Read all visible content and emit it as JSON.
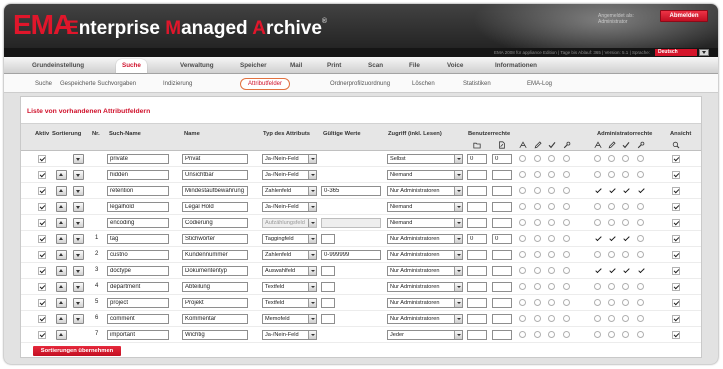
{
  "header": {
    "logo": "EMA",
    "title_parts": [
      "E",
      "nterprise ",
      "M",
      "anaged ",
      "A",
      "rchive",
      "®"
    ],
    "user_label": "Angemeldet als:",
    "user_name": "Administrator",
    "logout_label": "Abmelden"
  },
  "status_bar": {
    "text": "EMA 2008 für appliance Edition | Tage bis Ablauf: 365 | Version: 5.1 | Sprache:",
    "language": "Deutsch"
  },
  "nav": {
    "items": [
      "Grundeinstellung",
      "Suche",
      "Verwaltung",
      "Speicher",
      "Mail",
      "Print",
      "Scan",
      "File",
      "Voice",
      "Informationen"
    ],
    "active_index": 1
  },
  "subnav": {
    "items": [
      "Suche",
      "Gespeicherte Suchvorgaben",
      "Indizierung",
      "Attributfelder",
      "Ordnerprofilzuordnung",
      "Löschen",
      "Statistiken",
      "EMA-Log"
    ],
    "active_index": 3
  },
  "panel": {
    "title": "Liste von vorhandenen Attributfeldern",
    "columns": {
      "active": "Aktiv",
      "sort": "Sortierung",
      "nr": "Nr.",
      "search_name": "Such-Name",
      "name": "Name",
      "type": "Typ des Attributs",
      "valid_values": "Gültige Werte",
      "access": "Zugriff (inkl. Lesen)",
      "user_rights": "Benutzerrechte",
      "admin_rights": "Administratorrechte",
      "view": "Ansicht"
    },
    "user_right_icons": [
      "folder-icon",
      "document-edit-icon",
      "read-icon",
      "pencil-icon",
      "check-icon",
      "wrench-icon"
    ],
    "admin_right_icons": [
      "read-icon",
      "pencil-icon",
      "check-icon",
      "wrench-icon"
    ],
    "view_icon": "view-icon",
    "save_label": "Sortierungen übernehmen"
  },
  "rows": [
    {
      "active": true,
      "sort": [
        "down"
      ],
      "nr": "",
      "search_name": "private",
      "name": "Privat",
      "type": "Ja-/Nein-Feld",
      "type_disabled": false,
      "valid_values": null,
      "access": "Selbst",
      "user_limits": [
        "0",
        "0"
      ],
      "user_rights": [
        false,
        false,
        false,
        false
      ],
      "admin_rights": [
        false,
        false,
        false,
        false
      ],
      "view": true
    },
    {
      "active": true,
      "sort": [
        "up",
        "down"
      ],
      "nr": "",
      "search_name": "hidden",
      "name": "Unsichtbar",
      "type": "Ja-/Nein-Feld",
      "type_disabled": false,
      "valid_values": null,
      "access": "Niemand",
      "user_limits": [
        "",
        ""
      ],
      "user_rights": [
        false,
        false,
        false,
        false
      ],
      "admin_rights": [
        false,
        false,
        false,
        false
      ],
      "view": true
    },
    {
      "active": true,
      "sort": [
        "up",
        "down"
      ],
      "nr": "",
      "search_name": "retention",
      "name": "Mindestaufbewahrung",
      "type": "Zahlenfeld",
      "type_disabled": false,
      "valid_values": "0-365",
      "access": "Nur Administratoren",
      "user_limits": [
        "",
        ""
      ],
      "user_rights": [
        false,
        false,
        false,
        false
      ],
      "admin_rights": [
        true,
        true,
        true,
        true
      ],
      "view": true
    },
    {
      "active": true,
      "sort": [
        "up",
        "down"
      ],
      "nr": "",
      "search_name": "legalhold",
      "name": "Legal Hold",
      "type": "Ja-/Nein-Feld",
      "type_disabled": false,
      "valid_values": null,
      "access": "Niemand",
      "user_limits": [
        "",
        ""
      ],
      "user_rights": [
        false,
        false,
        false,
        false
      ],
      "admin_rights": [
        false,
        false,
        false,
        false
      ],
      "view": true
    },
    {
      "active": true,
      "sort": [
        "up",
        "down"
      ],
      "nr": "",
      "search_name": "encoding",
      "name": "Codierung",
      "type": "Aufzählungsfeld",
      "type_disabled": true,
      "valid_values": "",
      "access": "Niemand",
      "user_limits": [
        "",
        ""
      ],
      "user_rights": [
        false,
        false,
        false,
        false
      ],
      "admin_rights": [
        false,
        false,
        false,
        false
      ],
      "view": true
    },
    {
      "active": true,
      "sort": [
        "up",
        "down"
      ],
      "nr": "1",
      "search_name": "tag",
      "name": "Stichwörter",
      "type": "Taggingfeld",
      "type_disabled": false,
      "valid_values": "",
      "access": "Nur Administratoren",
      "user_limits": [
        "0",
        "0"
      ],
      "user_rights": [
        false,
        false,
        false,
        false
      ],
      "admin_rights": [
        true,
        true,
        true,
        false
      ],
      "view": true
    },
    {
      "active": true,
      "sort": [
        "up",
        "down"
      ],
      "nr": "2",
      "search_name": "custno",
      "name": "Kundennummer",
      "type": "Zahlenfeld",
      "type_disabled": false,
      "valid_values": "0-999999",
      "access": "Nur Administratoren",
      "user_limits": [
        "",
        ""
      ],
      "user_rights": [
        false,
        false,
        false,
        false
      ],
      "admin_rights": [
        false,
        false,
        false,
        false
      ],
      "view": true
    },
    {
      "active": true,
      "sort": [
        "up",
        "down"
      ],
      "nr": "3",
      "search_name": "doctype",
      "name": "Dokumententyp",
      "type": "Auswahlfeld",
      "type_disabled": false,
      "valid_values": "",
      "access": "Nur Administratoren",
      "user_limits": [
        "",
        ""
      ],
      "user_rights": [
        false,
        false,
        false,
        false
      ],
      "admin_rights": [
        true,
        true,
        true,
        true
      ],
      "view": true
    },
    {
      "active": true,
      "sort": [
        "up",
        "down"
      ],
      "nr": "4",
      "search_name": "department",
      "name": "Abteilung",
      "type": "Textfeld",
      "type_disabled": false,
      "valid_values": "",
      "access": "Nur Administratoren",
      "user_limits": [
        "",
        ""
      ],
      "user_rights": [
        false,
        false,
        false,
        false
      ],
      "admin_rights": [
        false,
        false,
        false,
        false
      ],
      "view": true
    },
    {
      "active": true,
      "sort": [
        "up",
        "down"
      ],
      "nr": "5",
      "search_name": "project",
      "name": "Projekt",
      "type": "Textfeld",
      "type_disabled": false,
      "valid_values": "",
      "access": "Nur Administratoren",
      "user_limits": [
        "",
        ""
      ],
      "user_rights": [
        false,
        false,
        false,
        false
      ],
      "admin_rights": [
        false,
        false,
        false,
        false
      ],
      "view": true
    },
    {
      "active": true,
      "sort": [
        "up",
        "down"
      ],
      "nr": "6",
      "search_name": "comment",
      "name": "Kommentar",
      "type": "Memofeld",
      "type_disabled": false,
      "valid_values": "",
      "access": "Nur Administratoren",
      "user_limits": [
        "",
        ""
      ],
      "user_rights": [
        false,
        false,
        false,
        false
      ],
      "admin_rights": [
        false,
        false,
        false,
        false
      ],
      "view": true
    },
    {
      "active": true,
      "sort": [
        "up"
      ],
      "nr": "7",
      "search_name": "important",
      "name": "Wichtig",
      "type": "Ja-/Nein-Feld",
      "type_disabled": false,
      "valid_values": null,
      "access": "Jeder",
      "user_limits": [
        "",
        ""
      ],
      "user_rights": [
        false,
        false,
        false,
        false
      ],
      "admin_rights": [
        false,
        false,
        false,
        false
      ],
      "view": true
    }
  ],
  "colors": {
    "accent": "#d0112b",
    "header_background": "#2e2e2e",
    "active_subtab_border": "#e2713f",
    "content_background": "#ffffff"
  }
}
